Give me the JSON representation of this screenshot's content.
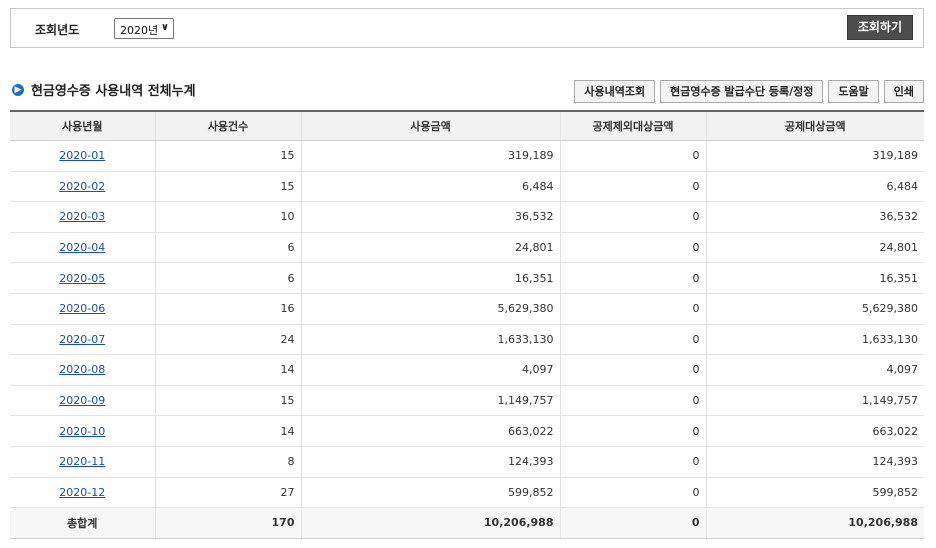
{
  "search": {
    "label": "조회년도",
    "year_value": "2020년",
    "button_label": "조회하기"
  },
  "section": {
    "title": "현금영수증 사용내역 전체누계",
    "buttons": [
      "사용내역조회",
      "현금영수증 발급수단 등록/정정",
      "도움말",
      "인쇄"
    ]
  },
  "table": {
    "headers": [
      "사용년월",
      "사용건수",
      "사용금액",
      "공제제외대상금액",
      "공제대상금액"
    ],
    "rows": [
      {
        "month": "2020-01",
        "count": "15",
        "amount": "319,189",
        "excluded": "0",
        "deductible": "319,189"
      },
      {
        "month": "2020-02",
        "count": "15",
        "amount": "6,484",
        "excluded": "0",
        "deductible": "6,484"
      },
      {
        "month": "2020-03",
        "count": "10",
        "amount": "36,532",
        "excluded": "0",
        "deductible": "36,532"
      },
      {
        "month": "2020-04",
        "count": "6",
        "amount": "24,801",
        "excluded": "0",
        "deductible": "24,801"
      },
      {
        "month": "2020-05",
        "count": "6",
        "amount": "16,351",
        "excluded": "0",
        "deductible": "16,351"
      },
      {
        "month": "2020-06",
        "count": "16",
        "amount": "5,629,380",
        "excluded": "0",
        "deductible": "5,629,380"
      },
      {
        "month": "2020-07",
        "count": "24",
        "amount": "1,633,130",
        "excluded": "0",
        "deductible": "1,633,130"
      },
      {
        "month": "2020-08",
        "count": "14",
        "amount": "4,097",
        "excluded": "0",
        "deductible": "4,097"
      },
      {
        "month": "2020-09",
        "count": "15",
        "amount": "1,149,757",
        "excluded": "0",
        "deductible": "1,149,757"
      },
      {
        "month": "2020-10",
        "count": "14",
        "amount": "663,022",
        "excluded": "0",
        "deductible": "663,022"
      },
      {
        "month": "2020-11",
        "count": "8",
        "amount": "124,393",
        "excluded": "0",
        "deductible": "124,393"
      },
      {
        "month": "2020-12",
        "count": "27",
        "amount": "599,852",
        "excluded": "0",
        "deductible": "599,852"
      }
    ],
    "total": {
      "label": "총합계",
      "count": "170",
      "amount": "10,206,988",
      "excluded": "0",
      "deductible": "10,206,988"
    }
  },
  "colors": {
    "accent": "#1f6fc5",
    "link": "#1a4fb4",
    "dark_button": "#4d4d4d"
  },
  "icons": {
    "section_bullet": "circle-arrow-right-icon",
    "select_chevron": "chevron-down-icon"
  }
}
